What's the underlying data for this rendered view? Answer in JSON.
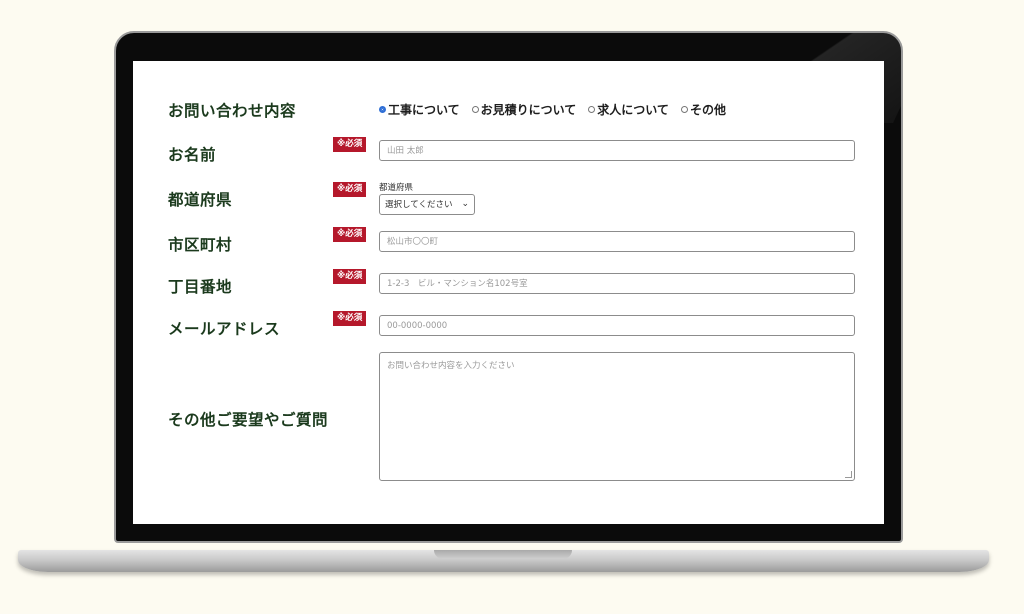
{
  "form": {
    "inquiry": {
      "label": "お問い合わせ内容",
      "options": [
        "工事について",
        "お見積りについて",
        "求人について",
        "その他"
      ],
      "selected_index": 0
    },
    "required_badge": "※必須",
    "name": {
      "label": "お名前",
      "placeholder": "山田 太郎"
    },
    "prefecture": {
      "label": "都道府県",
      "caption": "都道府県",
      "selected": "選択してください"
    },
    "city": {
      "label": "市区町村",
      "placeholder": "松山市〇〇町"
    },
    "address": {
      "label": "丁目番地",
      "placeholder": "1-2-3　ビル・マンション名102号室"
    },
    "email": {
      "label": "メールアドレス",
      "placeholder": "00-0000-0000"
    },
    "other": {
      "label": "その他ご要望やご質問",
      "placeholder": "お問い合わせ内容を入力ください"
    }
  },
  "colors": {
    "label": "#1b3a1d",
    "required_badge": "#b5182b",
    "page_background": "#fdfbf1"
  },
  "icons": {
    "select_arrow": "chevron-down-icon"
  }
}
